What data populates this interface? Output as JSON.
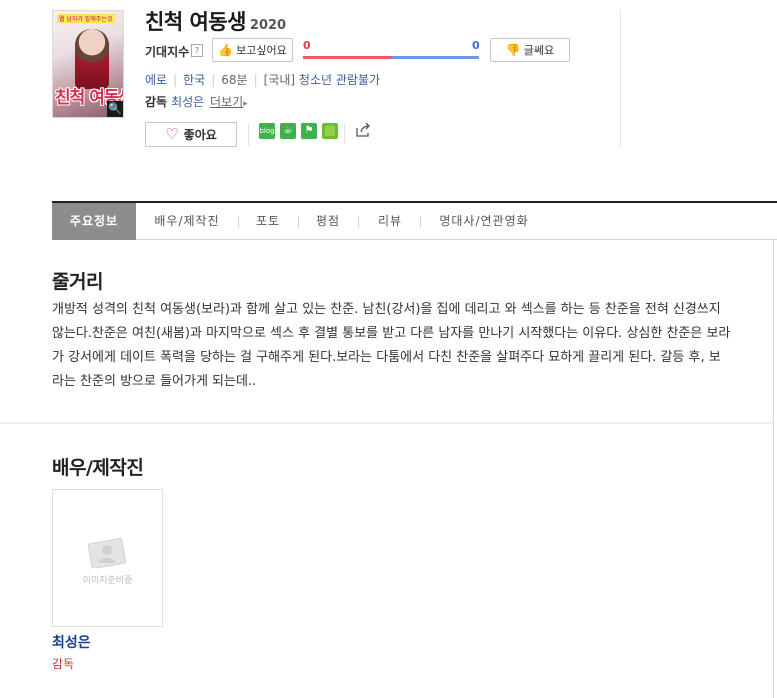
{
  "poster": {
    "top_text": "웹 남자가 말해주는것",
    "big_title": "친척 여동생"
  },
  "movie": {
    "title": "친척 여동생",
    "year": "2020"
  },
  "expectation": {
    "label": "기대지수",
    "help": "?",
    "want_label": "보고싶어요",
    "nah_label": "글쎄요",
    "want_count": "0",
    "nah_count": "0",
    "want_ratio": 0.5
  },
  "meta": {
    "genre": "에로",
    "country": "한국",
    "runtime": "68분",
    "rating_prefix": "[국내]",
    "rating": "청소년 관람불가"
  },
  "director": {
    "label": "감독",
    "name": "최성은",
    "more": "더보기"
  },
  "like_button": {
    "label": "좋아요"
  },
  "share": {
    "blog": "blog",
    "icons": [
      "blog-icon",
      "cafe-icon",
      "bookmark-icon",
      "memo-icon",
      "share-icon"
    ]
  },
  "tabs": [
    "주요정보",
    "배우/제작진",
    "포토",
    "평점",
    "리뷰",
    "명대사/연관영화"
  ],
  "synopsis": {
    "title": "줄거리",
    "text": "개방적 성격의 친척 여동생(보라)과 함께 살고 있는 찬준. 남친(강서)을 집에 데리고 와 섹스를 하는 등 찬준을 전혀 신경쓰지 않는다.찬준은 여친(새봄)과 마지막으로 섹스 후 결별 통보를 받고 다른 남자를 만나기 시작했다는 이유다. 상심한 찬준은 보라가 강서에게 데이트 폭력을 당하는 걸 구해주게 된다.보라는 다툼에서 다친 찬준을 살펴주다 묘하게 끌리게 된다. 갈등 후, 보라는 찬준의 방으로 들어가게 되는데.."
  },
  "cast": {
    "title": "배우/제작진",
    "items": [
      {
        "name": "최성은",
        "role": "감독",
        "placeholder": "이미지준비중"
      }
    ]
  },
  "colors": {
    "accent_red": "#e9394c",
    "accent_blue": "#3a6fd6",
    "link_blue": "#3b5e9a",
    "tab_active_bg": "#8d8d8d"
  }
}
